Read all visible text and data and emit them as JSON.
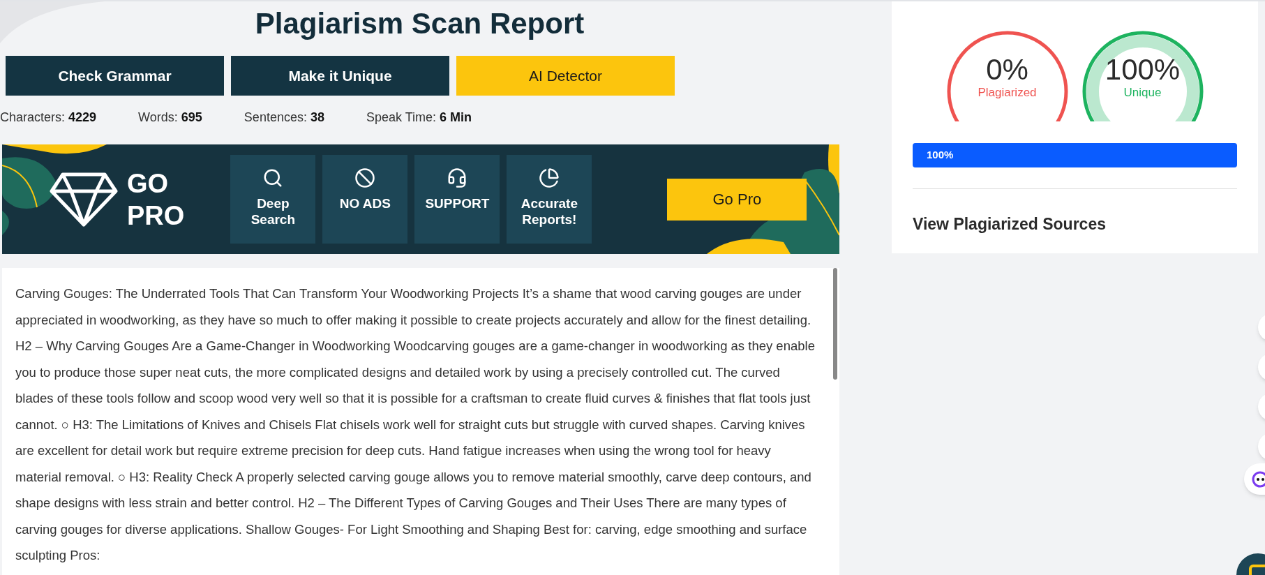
{
  "title": "Plagiarism Scan Report",
  "actions": [
    {
      "label": "Check Grammar",
      "kind": "dark"
    },
    {
      "label": "Make it Unique",
      "kind": "dark"
    },
    {
      "label": "AI Detector",
      "kind": "accent"
    }
  ],
  "stats": [
    {
      "label": "Characters:",
      "value": "4229"
    },
    {
      "label": "Words:",
      "value": "695"
    },
    {
      "label": "Sentences:",
      "value": "38"
    },
    {
      "label": "Speak Time:",
      "value": "6 Min"
    }
  ],
  "promo": {
    "brand_lines": [
      "GO",
      "PRO"
    ],
    "features": [
      {
        "kind": "search",
        "lines": [
          "Deep",
          "Search"
        ]
      },
      {
        "kind": "noads",
        "lines": [
          "NO ADS"
        ]
      },
      {
        "kind": "support",
        "lines": [
          "SUPPORT"
        ]
      },
      {
        "kind": "reports",
        "lines": [
          "Accurate",
          "Reports!"
        ]
      }
    ],
    "button": "Go Pro"
  },
  "content": "Carving Gouges: The Underrated Tools That Can Transform Your Woodworking Projects It’s a shame that wood carving gouges are under appreciated in woodworking, as they have so much to offer making it possible to create projects accurately and allow for the finest detailing. H2 – Why Carving Gouges Are a Game-Changer in Woodworking Woodcarving gouges are a game-changer in woodworking as they enable you to produce those super neat cuts, the more complicated designs and detailed work by using a precisely controlled cut. The curved blades of these tools follow and scoop wood very well so that it is possible for a craftsman to create fluid curves & finishes that flat tools just cannot. ○ H3: The Limitations of Knives and Chisels Flat chisels work well for straight cuts but struggle with curved shapes. Carving knives are excellent for detail work but require extreme precision for deep cuts. Hand fatigue increases when using the wrong tool for heavy material removal. ○ H3: Reality Check A properly selected carving gouge allows you to remove material smoothly, carve deep contours, and shape designs with less strain and better control. H2 – The Different Types of Carving Gouges and Their Uses There are many types of carving gouges for diverse applications. Shallow Gouges- For Light Smoothing and Shaping Best for: carving, edge smoothing and surface sculpting Pros:",
  "result": {
    "gauges": [
      {
        "value": "0%",
        "label": "Plagiarized",
        "kind": "outline",
        "color": "#ef5350"
      },
      {
        "value": "100%",
        "label": "Unique",
        "kind": "banded",
        "color": "#1db35f"
      }
    ],
    "progress": {
      "text": "100%",
      "level": 1
    },
    "sources_link": "View Plagiarized Sources"
  }
}
